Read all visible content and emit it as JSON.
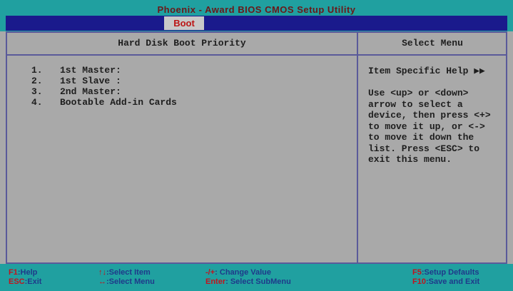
{
  "app": {
    "title": "Phoenix - Award BIOS CMOS Setup Utility"
  },
  "menu": {
    "active_tab": "Boot"
  },
  "left_panel": {
    "header": "Hard Disk Boot Priority",
    "items": [
      {
        "num": "1.",
        "label": "1st Master:"
      },
      {
        "num": "2.",
        "label": "1st Slave :"
      },
      {
        "num": "3.",
        "label": "2nd Master:"
      },
      {
        "num": "4.",
        "label": "Bootable Add-in Cards"
      }
    ]
  },
  "right_panel": {
    "header": "Select Menu",
    "help_title": "Item Specific Help ▶▶",
    "help_lines": [
      "Use <up> or <down>",
      "arrow to select a",
      "device, then press <+>",
      "to move it up, or <->",
      "to move it down the",
      "list. Press <ESC> to",
      "exit this menu."
    ]
  },
  "footer": {
    "f1_key": "F1",
    "f1_text": ":Help",
    "esc_key": "ESC",
    "esc_text": ":Exit",
    "updown_key": "↑↓",
    "updown_text": ":Select Item",
    "leftright_key": "↔",
    "leftright_text": ":Select Menu",
    "plusminus_key": "-/+",
    "plusminus_text": ": Change Value",
    "enter_key": "Enter",
    "enter_text": ": Select SubMenu",
    "f5_key": "F5",
    "f5_text": ":Setup Defaults",
    "f10_key": "F10",
    "f10_text": ":Save and Exit"
  }
}
